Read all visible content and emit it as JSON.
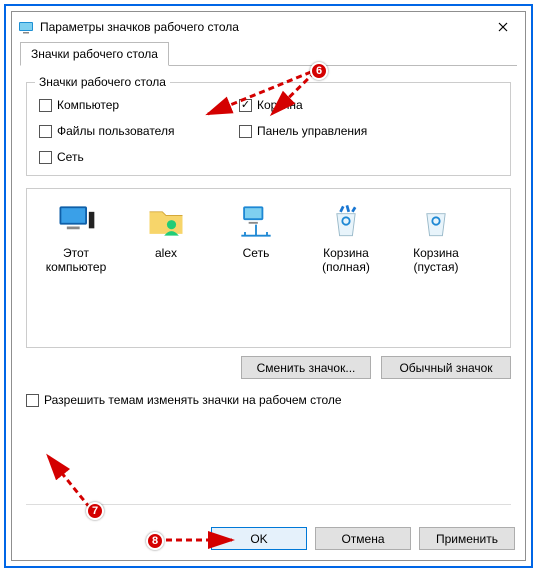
{
  "window": {
    "title": "Параметры значков рабочего стола"
  },
  "tabs": {
    "tab1": "Значки рабочего стола"
  },
  "group": {
    "title": "Значки рабочего стола",
    "computer": "Компьютер",
    "userfiles": "Файлы пользователя",
    "network": "Сеть",
    "recycle": "Корзина",
    "controlpanel": "Панель управления"
  },
  "checked": {
    "computer": false,
    "userfiles": false,
    "network": false,
    "recycle": true,
    "controlpanel": false,
    "allowthemes": false
  },
  "icons": {
    "thispc": "Этот компьютер",
    "user": "alex",
    "net": "Сеть",
    "binfull": "Корзина (полная)",
    "binempty": "Корзина (пустая)"
  },
  "buttons": {
    "changeicon": "Сменить значок...",
    "defaulticon": "Обычный значок",
    "ok": "OK",
    "cancel": "Отмена",
    "apply": "Применить"
  },
  "allowthemes": "Разрешить темам изменять значки на рабочем столе",
  "annotations": {
    "b6": "6",
    "b7": "7",
    "b8": "8"
  }
}
